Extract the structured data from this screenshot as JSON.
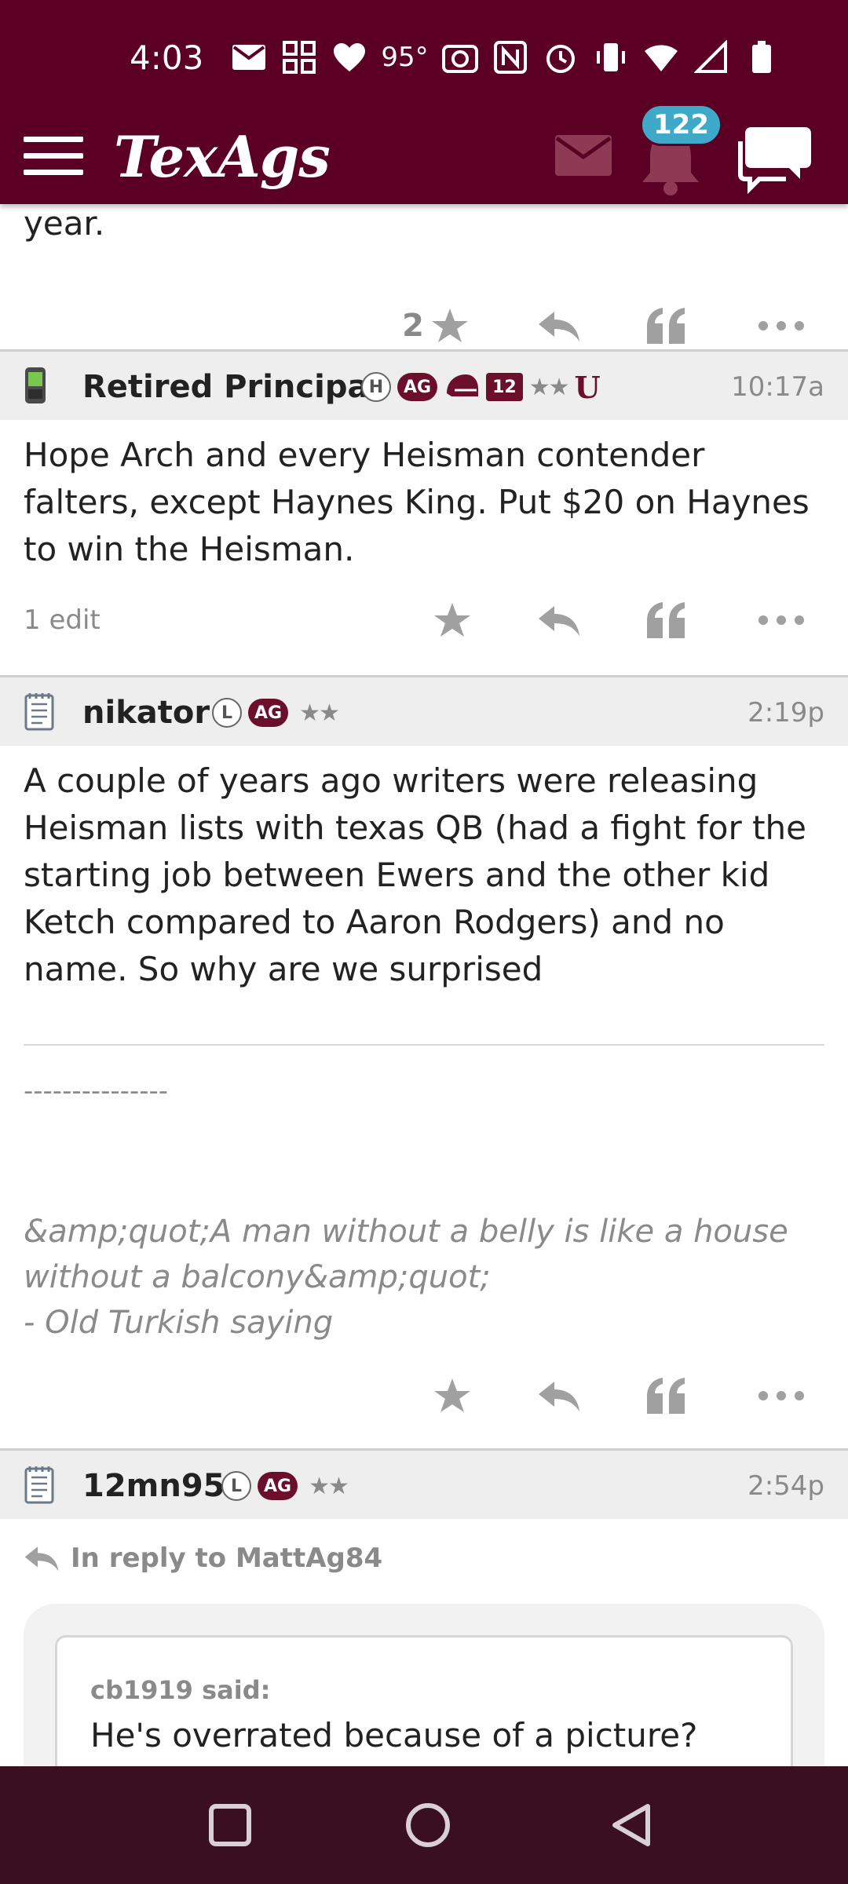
{
  "status_bar": {
    "time": "4:03",
    "temperature": "95°",
    "icons": [
      "mail-icon",
      "grid-icon",
      "heart-icon",
      "camera-icon",
      "nfc-icon",
      "alarm-icon",
      "vibrate-icon",
      "wifi-icon",
      "signal-icon",
      "battery-icon"
    ]
  },
  "header": {
    "logo": "TexAgs",
    "notification_count": "122"
  },
  "previous_post": {
    "text_fragment": "year.",
    "like_count": "2"
  },
  "posts": [
    {
      "author": "Retired Principal",
      "badges": [
        "H",
        "AG",
        "12",
        "★★",
        "U"
      ],
      "time": "10:17a",
      "body": "Hope Arch and every Heisman contender falters, except Haynes King. Put $20 on Haynes to win the Heisman.",
      "edit_note": "1 edit"
    },
    {
      "author": "nikator",
      "badges": [
        "L",
        "AG",
        "★★"
      ],
      "time": "2:19p",
      "body": "A couple of years ago writers were releasing Heisman lists with texas QB (had a fight for the starting job between Ewers and the other kid Ketch compared to Aaron Rodgers) and no name. So why are we surprised",
      "signature_dashes": "---------------",
      "signature_line1": "&amp;quot;A man without a belly is like a house",
      "signature_line2": "without a balcony&amp;quot;",
      "signature_line3": "- Old Turkish saying"
    },
    {
      "author": "12mn95",
      "badges": [
        "L",
        "AG",
        "★★"
      ],
      "time": "2:54p",
      "reply_to": "In reply to MattAg84",
      "quote_author": "cb1919 said:",
      "quote_text": "He's overrated because of a picture?"
    }
  ]
}
